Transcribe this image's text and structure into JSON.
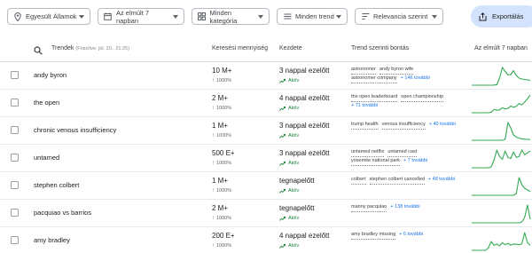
{
  "filters": [
    {
      "label": "Egyesült Államok",
      "icon": "location-pin-icon"
    },
    {
      "label": "Az elmúlt 7 napban",
      "icon": "calendar-icon"
    },
    {
      "label": "Minden kategória",
      "icon": "grid-icon"
    },
    {
      "label": "Minden trend",
      "icon": "tune-icon"
    },
    {
      "label": "Relevancia szerint",
      "icon": "sort-icon"
    }
  ],
  "export_label": "Exportálás",
  "header": {
    "trends": "Trendek",
    "trends_sub": "(Frissítve: júl. 20., 21:25)",
    "volume": "Keresési mennyiség",
    "started": "Kezdete",
    "breakdown": "Trend szerinti bontás",
    "last7": "Az elmúlt 7 napban"
  },
  "colors": {
    "accent": "#1a73e8",
    "spark": "#34a853",
    "active": "#188038",
    "export_bg": "#d3e3fd"
  },
  "rows": [
    {
      "term": "andy byron",
      "volume": "10 M+",
      "pct": "1000%",
      "started": "3 nappal ezelőtt",
      "status": "Aktív",
      "tags": [
        "astronomer",
        "andy byron wife",
        "astronomer company"
      ],
      "more": "+ 146 további",
      "spark": [
        0,
        0,
        0,
        0,
        0,
        0,
        0,
        0,
        1,
        3,
        40,
        100,
        78,
        58,
        60,
        82,
        55,
        40,
        35,
        32,
        30,
        28
      ]
    },
    {
      "term": "the open",
      "volume": "2 M+",
      "pct": "1000%",
      "started": "4 nappal ezelőtt",
      "status": "Aktív",
      "tags": [
        "the open leaderboard",
        "open championship"
      ],
      "more": "+ 71 további",
      "spark": [
        0,
        0,
        0,
        0,
        0,
        0,
        0,
        3,
        18,
        14,
        16,
        28,
        22,
        24,
        38,
        30,
        36,
        52,
        45,
        60,
        78,
        100
      ]
    },
    {
      "term": "chronic venous insufficiency",
      "volume": "1 M+",
      "pct": "1000%",
      "started": "3 nappal ezelőtt",
      "status": "Aktív",
      "tags": [
        "trump health",
        "venous insufficiency"
      ],
      "more": "+ 40 további",
      "spark": [
        0,
        0,
        0,
        0,
        0,
        0,
        0,
        0,
        0,
        0,
        0,
        0,
        5,
        100,
        70,
        30,
        18,
        12,
        8,
        6,
        5,
        4
      ]
    },
    {
      "term": "untamed",
      "volume": "500 E+",
      "pct": "1000%",
      "started": "3 nappal ezelőtt",
      "status": "Aktív",
      "tags": [
        "untamed netflix",
        "untamed cast",
        "yosemite national park"
      ],
      "more": "+ 7 további",
      "spark": [
        0,
        0,
        0,
        0,
        0,
        0,
        0,
        5,
        40,
        95,
        60,
        45,
        90,
        55,
        50,
        85,
        55,
        60,
        95,
        70,
        80,
        90
      ]
    },
    {
      "term": "stephen colbert",
      "volume": "1 M+",
      "pct": "1000%",
      "started": "tegnapelőtt",
      "status": "Aktív",
      "tags": [
        "colbert",
        "stephen colbert cancelled"
      ],
      "more": "+ 48 további",
      "spark": [
        0,
        0,
        0,
        0,
        0,
        0,
        0,
        0,
        0,
        0,
        0,
        0,
        0,
        0,
        0,
        0,
        10,
        100,
        60,
        40,
        30,
        22
      ]
    },
    {
      "term": "pacquiao vs barrios",
      "volume": "2 M+",
      "pct": "1000%",
      "started": "tegnapelőtt",
      "status": "Aktív",
      "tags": [
        "manny pacquiao"
      ],
      "more": "+ 138 további",
      "spark": [
        0,
        0,
        0,
        0,
        0,
        0,
        0,
        0,
        0,
        0,
        0,
        0,
        0,
        0,
        0,
        0,
        0,
        0,
        5,
        30,
        100,
        20
      ]
    },
    {
      "term": "amy bradley",
      "volume": "200 E+",
      "pct": "1000%",
      "started": "4 nappal ezelőtt",
      "status": "Aktív",
      "tags": [
        "amy bradley missing"
      ],
      "more": "+ 6 további",
      "spark": [
        0,
        0,
        0,
        0,
        0,
        0,
        10,
        35,
        20,
        25,
        18,
        30,
        22,
        28,
        20,
        25,
        24,
        22,
        26,
        70,
        30,
        20
      ]
    }
  ]
}
